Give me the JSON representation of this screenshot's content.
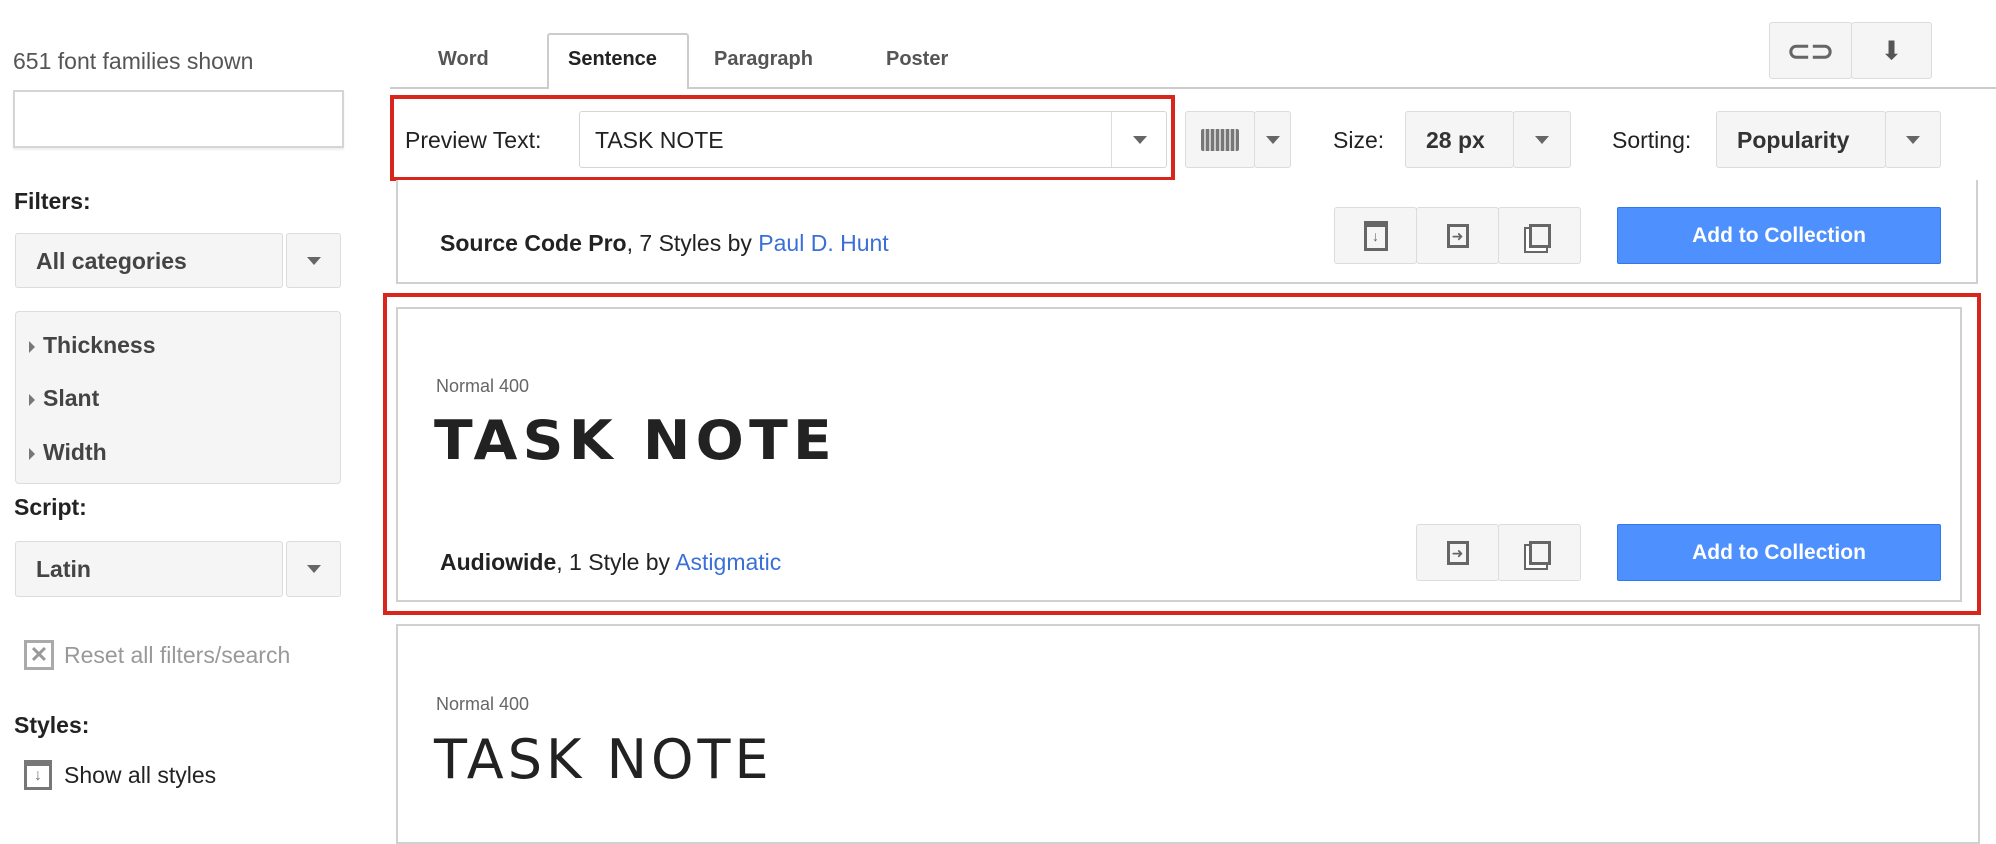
{
  "sidebar": {
    "count_text": "651 font families shown",
    "search_value": "",
    "filters_label": "Filters:",
    "category_select": "All categories",
    "filter_items": [
      {
        "label": "Thickness"
      },
      {
        "label": "Slant"
      },
      {
        "label": "Width"
      }
    ],
    "script_label": "Script:",
    "script_select": "Latin",
    "reset_label": "Reset all filters/search",
    "styles_label": "Styles:",
    "show_all_styles": "Show all styles"
  },
  "tabs": [
    {
      "label": "Word"
    },
    {
      "label": "Sentence",
      "active": true
    },
    {
      "label": "Paragraph"
    },
    {
      "label": "Poster"
    }
  ],
  "toolbar": {
    "preview_label": "Preview Text:",
    "preview_value": "TASK NOTE",
    "size_label": "Size:",
    "size_value": "28 px",
    "sorting_label": "Sorting:",
    "sorting_value": "Popularity"
  },
  "cards": [
    {
      "name": "Source Code Pro",
      "meta": ", 7 Styles by ",
      "author": "Paul D. Hunt",
      "button": "Add to Collection"
    },
    {
      "style": "Normal 400",
      "sample": "TASK NOTE",
      "name": "Audiowide",
      "meta": ", 1 Style by ",
      "author": "Astigmatic",
      "button": "Add to Collection"
    },
    {
      "style": "Normal 400",
      "sample": "TASK NOTE"
    }
  ],
  "colors": {
    "accent": "#4d90fe",
    "link": "#3a6fd8",
    "highlight": "#d9261c"
  }
}
